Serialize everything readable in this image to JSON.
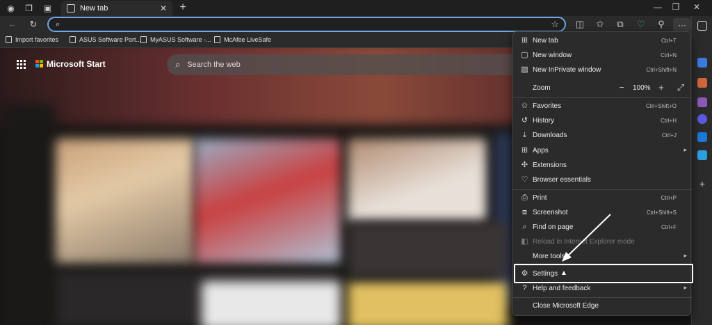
{
  "tab": {
    "title": "New tab"
  },
  "address": {
    "value": ""
  },
  "favorites": [
    {
      "label": "Import favorites"
    },
    {
      "label": "ASUS Software Port..."
    },
    {
      "label": "MyASUS Software -..."
    },
    {
      "label": "McAfee LiveSafe"
    }
  ],
  "page": {
    "brand": "Microsoft Start",
    "search_placeholder": "Search the web"
  },
  "menu": {
    "items": [
      {
        "label": "New tab",
        "shortcut": "Ctrl+T",
        "icon": "new-tab-icon"
      },
      {
        "label": "New window",
        "shortcut": "Ctrl+N",
        "icon": "new-window-icon"
      },
      {
        "label": "New InPrivate window",
        "shortcut": "Ctrl+Shift+N",
        "icon": "inprivate-icon"
      },
      {
        "label": "Favorites",
        "shortcut": "Ctrl+Shift+O",
        "icon": "favorites-icon"
      },
      {
        "label": "History",
        "shortcut": "Ctrl+H",
        "icon": "history-icon"
      },
      {
        "label": "Downloads",
        "shortcut": "Ctrl+J",
        "icon": "download-icon"
      },
      {
        "label": "Apps",
        "shortcut": "",
        "icon": "apps-icon"
      },
      {
        "label": "Extensions",
        "shortcut": "",
        "icon": "extensions-icon"
      },
      {
        "label": "Browser essentials",
        "shortcut": "",
        "icon": "heart-icon"
      },
      {
        "label": "Print",
        "shortcut": "Ctrl+P",
        "icon": "print-icon"
      },
      {
        "label": "Screenshot",
        "shortcut": "Ctrl+Shift+S",
        "icon": "screenshot-icon"
      },
      {
        "label": "Find on page",
        "shortcut": "Ctrl+F",
        "icon": "find-icon"
      },
      {
        "label": "Reload in Internet Explorer mode",
        "shortcut": "",
        "icon": "ie-mode-icon"
      },
      {
        "label": "More tools",
        "shortcut": "",
        "icon": ""
      },
      {
        "label": "Settings",
        "shortcut": "",
        "icon": "gear-icon"
      },
      {
        "label": "Help and feedback",
        "shortcut": "",
        "icon": "help-icon"
      },
      {
        "label": "Close Microsoft Edge",
        "shortcut": "",
        "icon": ""
      }
    ],
    "zoom": {
      "label": "Zoom",
      "value": "100%"
    }
  }
}
